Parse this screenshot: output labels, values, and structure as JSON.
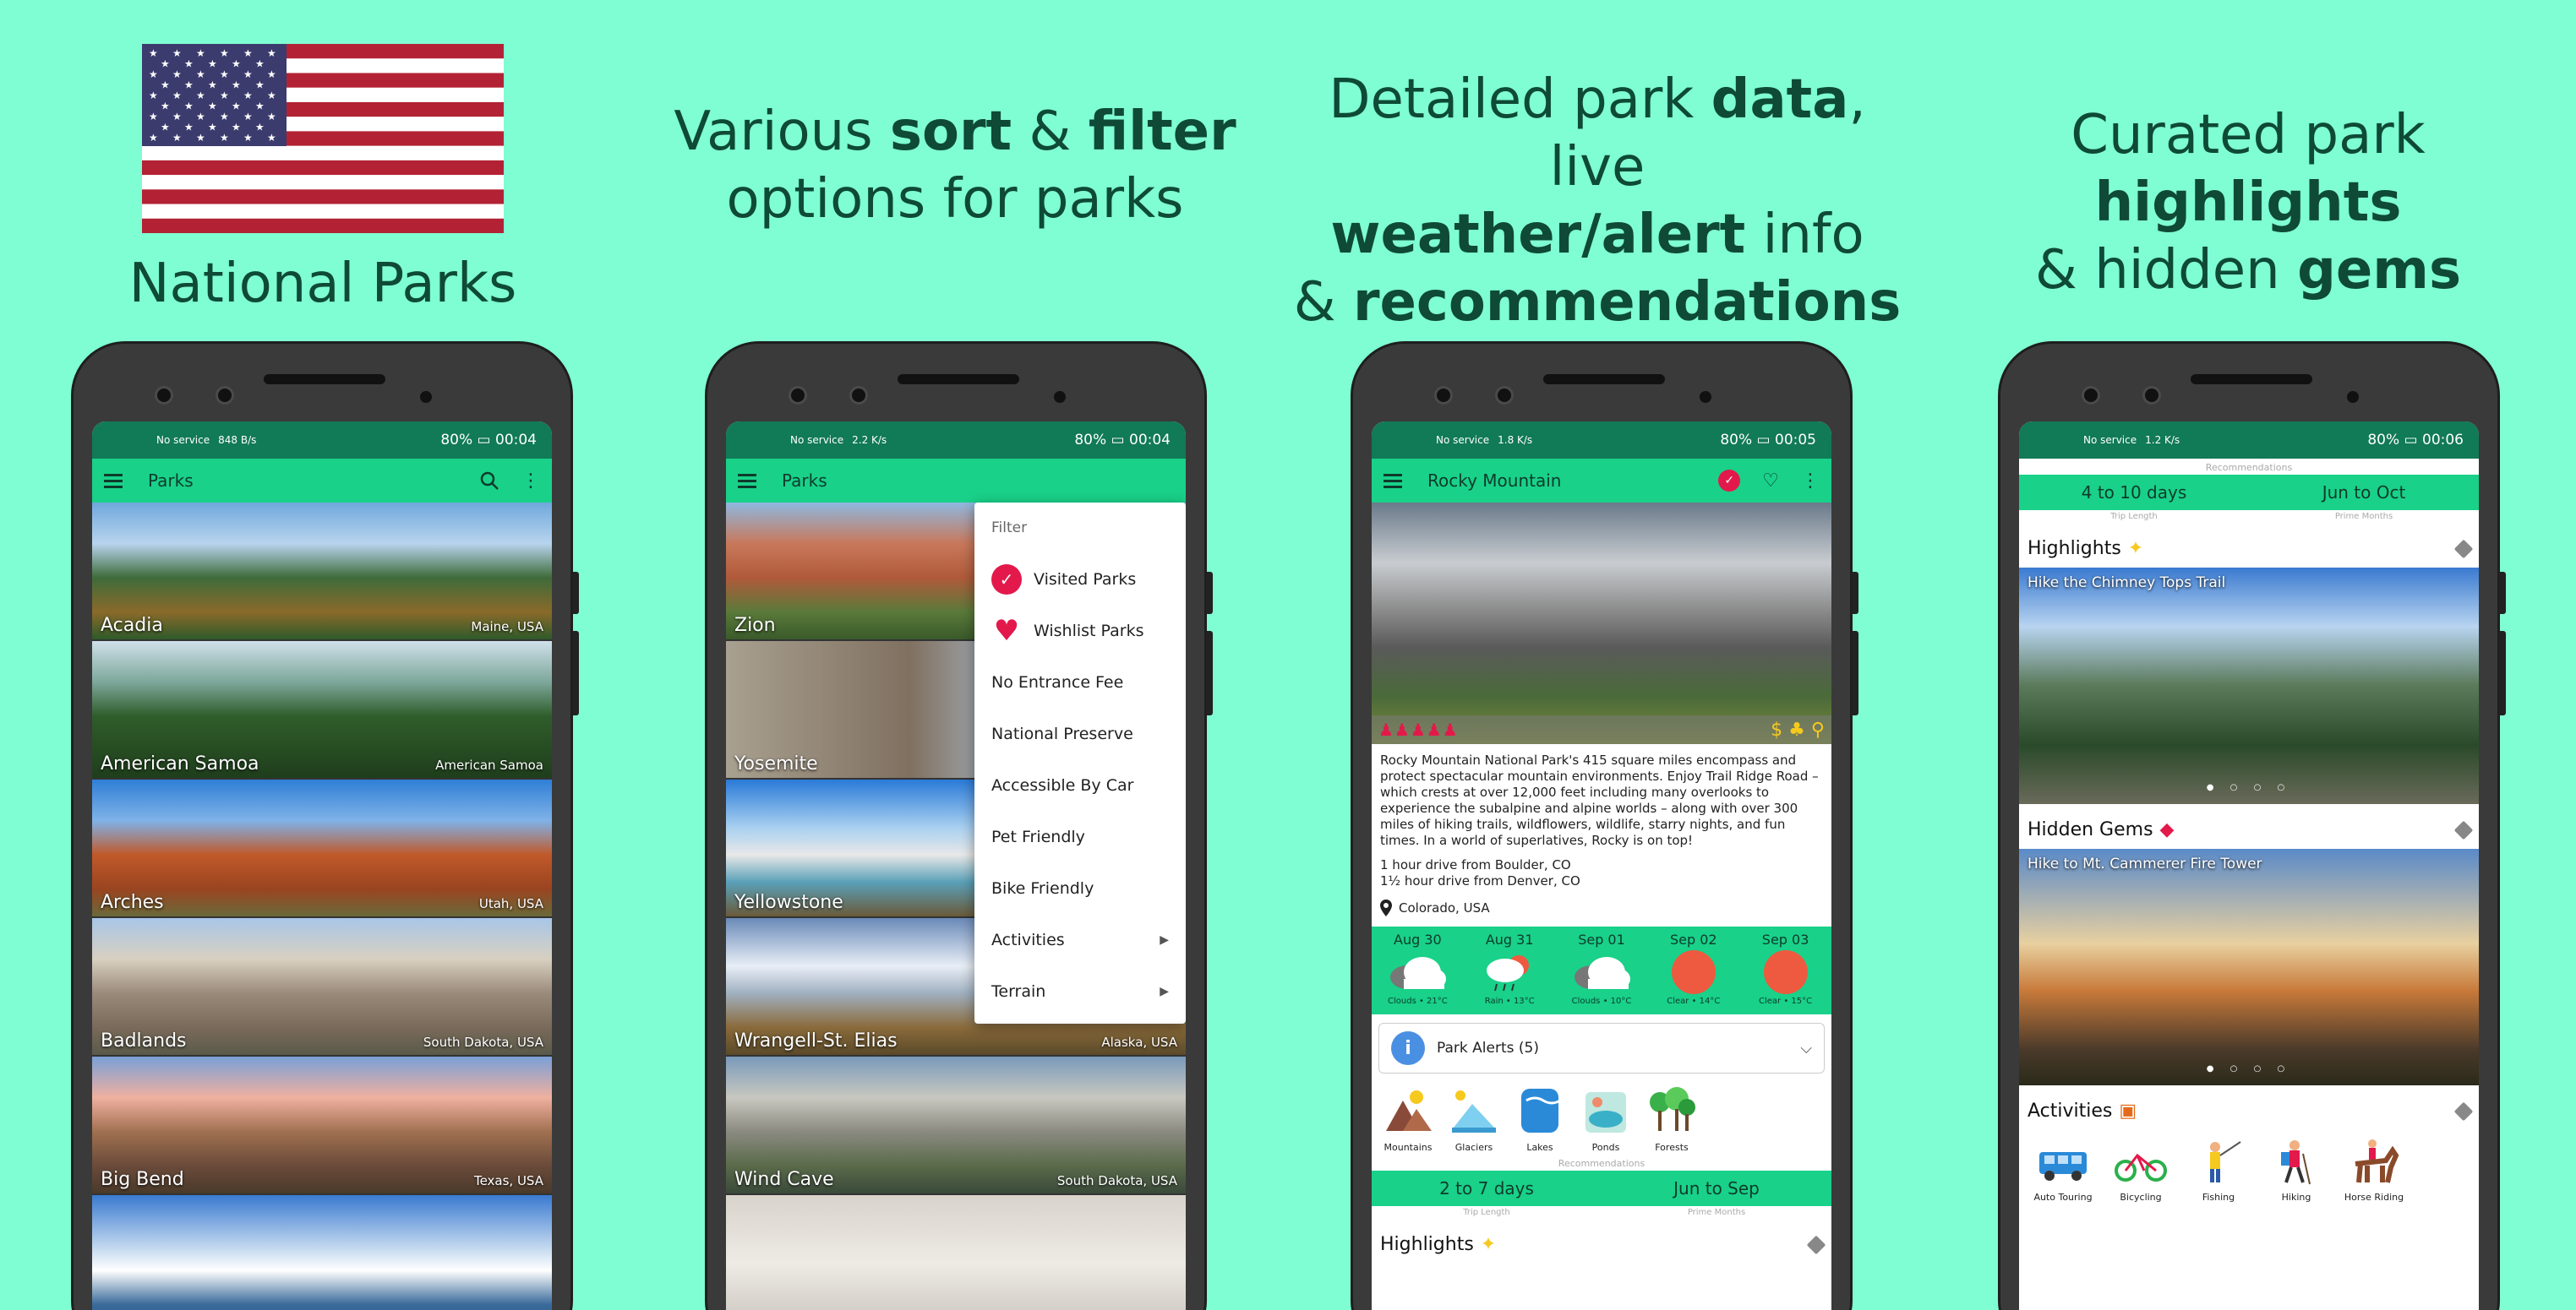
{
  "banner": {
    "title": "National Parks",
    "caption2_pre": "Various ",
    "caption2_b1": "sort",
    "caption2_mid": " & ",
    "caption2_b2": "filter",
    "caption2_line2": "options for parks",
    "caption3_l1_pre": "Detailed park ",
    "caption3_l1_b": "data",
    "caption3_l1_post": ", live",
    "caption3_l2_b": "weather/alert",
    "caption3_l2_post": " info",
    "caption3_l3_pre": "& ",
    "caption3_l3_b": "recommendations",
    "caption4_l1_pre": "Curated park ",
    "caption4_l1_b": "highlights",
    "caption4_l2_pre": "& hidden ",
    "caption4_l2_b": "gems"
  },
  "colors": {
    "background": "#7ffdd3",
    "statusbar": "#117a56",
    "accent": "#19d189",
    "heart": "#e3194b"
  },
  "phone1": {
    "status": {
      "service": "No service",
      "speed": "848 B/s",
      "battery": "80%",
      "time": "00:04"
    },
    "appbar_title": "Parks",
    "icons": [
      "menu-icon",
      "search-icon",
      "more-vert-icon"
    ],
    "parks": [
      {
        "name": "Acadia",
        "location": "Maine, USA"
      },
      {
        "name": "American Samoa",
        "location": "American Samoa"
      },
      {
        "name": "Arches",
        "location": "Utah, USA"
      },
      {
        "name": "Badlands",
        "location": "South Dakota, USA"
      },
      {
        "name": "Big Bend",
        "location": "Texas, USA"
      },
      {
        "name": "",
        "location": ""
      }
    ]
  },
  "phone2": {
    "status": {
      "service": "No service",
      "speed": "2.2 K/s",
      "battery": "80%",
      "time": "00:04"
    },
    "appbar_title": "Parks",
    "parks": [
      {
        "name": "Zion",
        "location": ""
      },
      {
        "name": "Yosemite",
        "location": ""
      },
      {
        "name": "Yellowstone",
        "location": ""
      },
      {
        "name": "Wrangell-St. Elias",
        "location": "Alaska, USA"
      },
      {
        "name": "Wind Cave",
        "location": "South Dakota, USA"
      },
      {
        "name": "",
        "location": ""
      }
    ],
    "filter_menu": {
      "heading": "Filter",
      "items": [
        "Visited Parks",
        "Wishlist Parks",
        "No Entrance Fee",
        "National Preserve",
        "Accessible By Car",
        "Pet Friendly",
        "Bike Friendly",
        "Activities",
        "Terrain"
      ]
    }
  },
  "phone3": {
    "status": {
      "service": "No service",
      "speed": "1.8 K/s",
      "battery": "80%",
      "time": "00:05"
    },
    "appbar_title": "Rocky Mountain",
    "description": "Rocky Mountain National Park's 415 square miles encompass and protect spectacular mountain environments. Enjoy Trail Ridge Road – which crests at over 12,000 feet including many overlooks to experience the subalpine and alpine worlds – along with over 300 miles of hiking trails, wildflowers, wildlife, starry nights, and fun times. In a world of superlatives, Rocky is on top!",
    "drive1": "1 hour drive from Boulder, CO",
    "drive2": "1½ hour drive from Denver, CO",
    "location": "Colorado, USA",
    "forecast": [
      {
        "date": "Aug 30",
        "cond": "Clouds • 21°C",
        "icon": "cloud-icon"
      },
      {
        "date": "Aug 31",
        "cond": "Rain • 13°C",
        "icon": "rain-icon"
      },
      {
        "date": "Sep 01",
        "cond": "Clouds • 10°C",
        "icon": "cloud-icon"
      },
      {
        "date": "Sep 02",
        "cond": "Clear • 14°C",
        "icon": "sun-icon"
      },
      {
        "date": "Sep 03",
        "cond": "Clear • 15°C",
        "icon": "sun-icon"
      }
    ],
    "alerts_label": "Park Alerts (5)",
    "terrain": [
      "Mountains",
      "Glaciers",
      "Lakes",
      "Ponds",
      "Forests"
    ],
    "rec_label": "Recommendations",
    "trip_length": "2 to 7 days",
    "prime_months": "Jun to Sep",
    "trip_length_label": "Trip Length",
    "prime_months_label": "Prime Months",
    "highlights_label": "Highlights"
  },
  "phone4": {
    "status": {
      "service": "No service",
      "speed": "1.2 K/s",
      "battery": "80%",
      "time": "00:06"
    },
    "rec_label": "Recommendations",
    "trip_length": "4 to 10 days",
    "prime_months": "Jun to Oct",
    "trip_length_label": "Trip Length",
    "prime_months_label": "Prime Months",
    "highlights_label": "Highlights",
    "highlight_caption": "Hike the Chimney Tops Trail",
    "gems_label": "Hidden Gems",
    "gem_caption": "Hike to Mt. Cammerer Fire Tower",
    "activities_label": "Activities",
    "activities": [
      "Auto Touring",
      "Bicycling",
      "Fishing",
      "Hiking",
      "Horse Riding"
    ]
  }
}
